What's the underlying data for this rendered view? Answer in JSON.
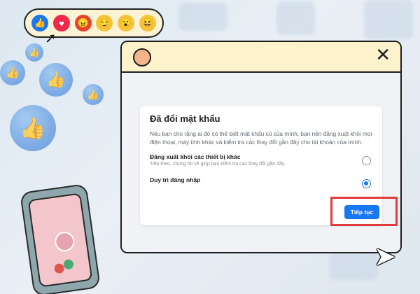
{
  "reactions": [
    "like-icon",
    "love-icon",
    "angry-icon",
    "meh-icon",
    "wow-icon",
    "haha-icon"
  ],
  "dialog": {
    "title": "Đã đổi mật khẩu",
    "description": "Nếu bạn cho rằng ai đó có thể biết mật khẩu cũ của mình, bạn nên đăng xuất khỏi mọi điện thoại, máy tính khác và kiểm tra các thay đổi gần đây cho tài khoản của mình.",
    "option_logout_title": "Đăng xuất khỏi các thiết bị khác",
    "option_logout_subtitle": "Tiếp theo, chúng tôi sẽ giúp bạn kiểm tra các thay đổi gần đây.",
    "option_stay_title": "Duy trì đăng nhập",
    "selected_option": "stay",
    "continue_label": "Tiếp tục"
  },
  "colors": {
    "accent": "#1877f2",
    "highlight": "#e03a3a",
    "titlebar": "#fcf2cc"
  }
}
